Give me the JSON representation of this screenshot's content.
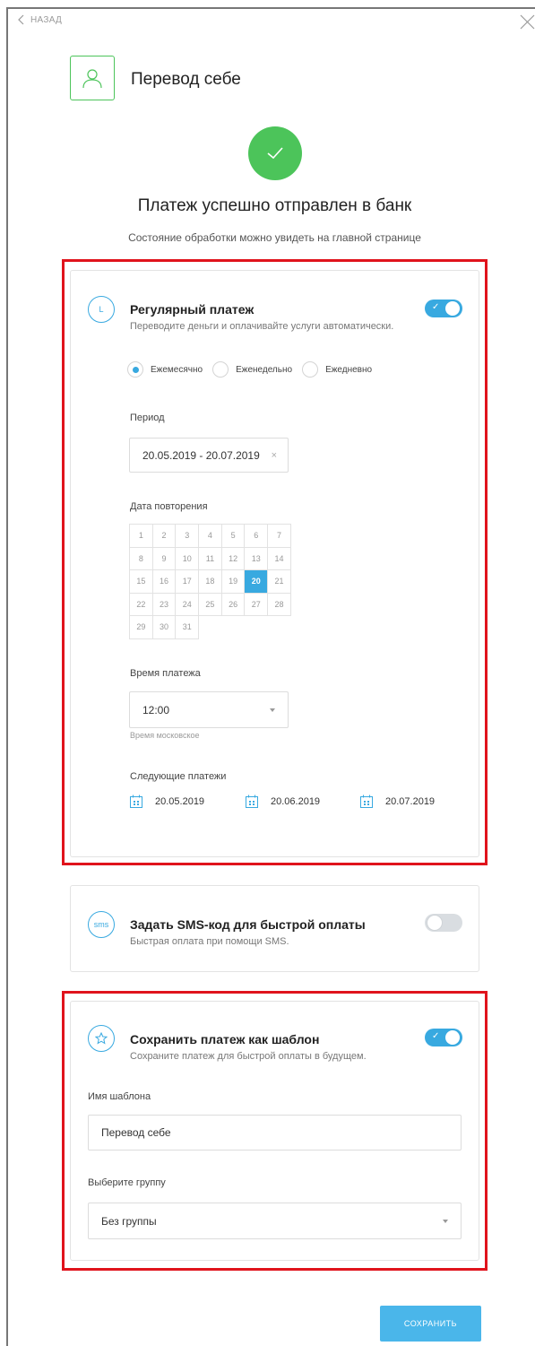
{
  "nav": {
    "back_label": "НАЗАД"
  },
  "header": {
    "title": "Перевод себе"
  },
  "success": {
    "title": "Платеж успешно отправлен в банк",
    "subtitle": "Состояние обработки можно увидеть на главной странице"
  },
  "regular": {
    "title": "Регулярный платеж",
    "subtitle": "Переводите деньги и оплачивайте услуги автоматически.",
    "toggle_on": true,
    "icon_glyph": "L",
    "frequency": {
      "options": [
        "Ежемесячно",
        "Еженедельно",
        "Ежедневно"
      ],
      "selected": 0
    },
    "period": {
      "label": "Период",
      "value": "20.05.2019 - 20.07.2019",
      "clear_glyph": "×"
    },
    "repeat_date": {
      "label": "Дата повторения",
      "days": [
        "1",
        "2",
        "3",
        "4",
        "5",
        "6",
        "7",
        "8",
        "9",
        "10",
        "11",
        "12",
        "13",
        "14",
        "15",
        "16",
        "17",
        "18",
        "19",
        "20",
        "21",
        "22",
        "23",
        "24",
        "25",
        "26",
        "27",
        "28",
        "29",
        "30",
        "31"
      ],
      "selected": "20"
    },
    "time": {
      "label": "Время платежа",
      "value": "12:00",
      "hint": "Время московское"
    },
    "next_payments": {
      "label": "Следующие платежи",
      "dates": [
        "20.05.2019",
        "20.06.2019",
        "20.07.2019"
      ]
    }
  },
  "sms": {
    "title": "Задать SMS-код для быстрой оплаты",
    "subtitle": "Быстрая оплата при помощи SMS.",
    "icon_text": "sms",
    "toggle_on": false
  },
  "template": {
    "title": "Сохранить платеж как шаблон",
    "subtitle": "Сохраните платеж для быстрой оплаты в будущем.",
    "toggle_on": true,
    "name_label": "Имя шаблона",
    "name_value": "Перевод себе",
    "group_label": "Выберите группу",
    "group_value": "Без группы"
  },
  "actions": {
    "save_label": "СОХРАНИТЬ"
  },
  "colors": {
    "accent": "#38a9e0",
    "success": "#4cc45a",
    "highlight": "#e0131c"
  }
}
